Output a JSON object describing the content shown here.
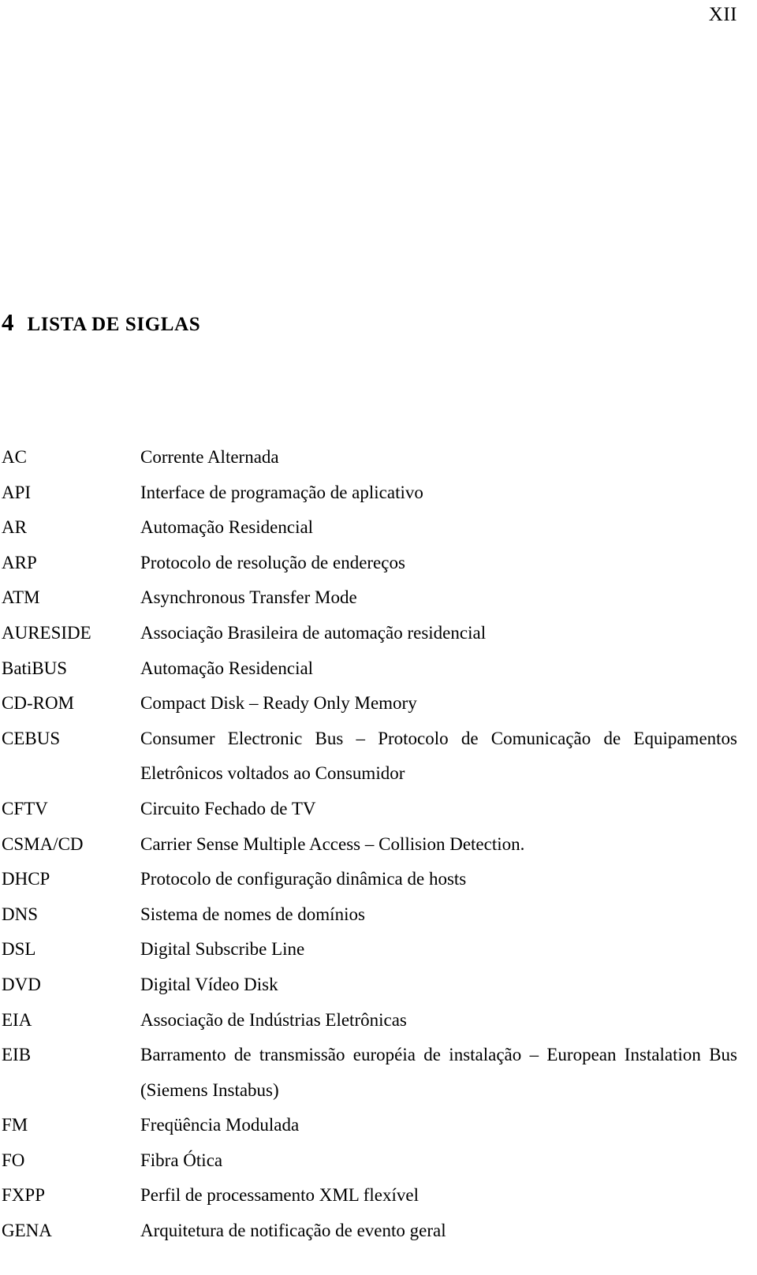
{
  "page": {
    "folio": "XII"
  },
  "heading": {
    "number": "4",
    "title": "LISTA DE SIGLAS"
  },
  "glossary": {
    "entries": [
      {
        "term": "AC",
        "definition": "Corrente Alternada"
      },
      {
        "term": "API",
        "definition": "Interface de programação de aplicativo"
      },
      {
        "term": "AR",
        "definition": "Automação Residencial"
      },
      {
        "term": "ARP",
        "definition": "Protocolo de resolução de endereços"
      },
      {
        "term": "ATM",
        "definition": "Asynchronous Transfer Mode"
      },
      {
        "term": "AURESIDE",
        "definition": "Associação Brasileira de automação residencial"
      },
      {
        "term": "BatiBUS",
        "definition": "Automação Residencial"
      },
      {
        "term": "CD-ROM",
        "definition": "Compact Disk – Ready Only Memory"
      },
      {
        "term": "CEBUS",
        "definition": "Consumer Electronic Bus – Protocolo de Comunicação de Equipamentos Eletrônicos voltados ao Consumidor"
      },
      {
        "term": "CFTV",
        "definition": "Circuito Fechado de TV"
      },
      {
        "term": "CSMA/CD",
        "definition": "Carrier Sense Multiple Access – Collision Detection."
      },
      {
        "term": "DHCP",
        "definition": "Protocolo de configuração dinâmica de hosts"
      },
      {
        "term": "DNS",
        "definition": "Sistema de nomes de domínios"
      },
      {
        "term": "DSL",
        "definition": "Digital Subscribe Line"
      },
      {
        "term": "DVD",
        "definition": "Digital Vídeo Disk"
      },
      {
        "term": "EIA",
        "definition": "Associação de Indústrias Eletrônicas"
      },
      {
        "term": "EIB",
        "definition": "Barramento de transmissão européia de instalação – European Instalation Bus (Siemens Instabus)"
      },
      {
        "term": "FM",
        "definition": "Freqüência Modulada"
      },
      {
        "term": "FO",
        "definition": "Fibra Ótica"
      },
      {
        "term": "FXPP",
        "definition": "Perfil de processamento XML flexível"
      },
      {
        "term": "GENA",
        "definition": "Arquitetura de notificação de evento geral"
      }
    ]
  }
}
